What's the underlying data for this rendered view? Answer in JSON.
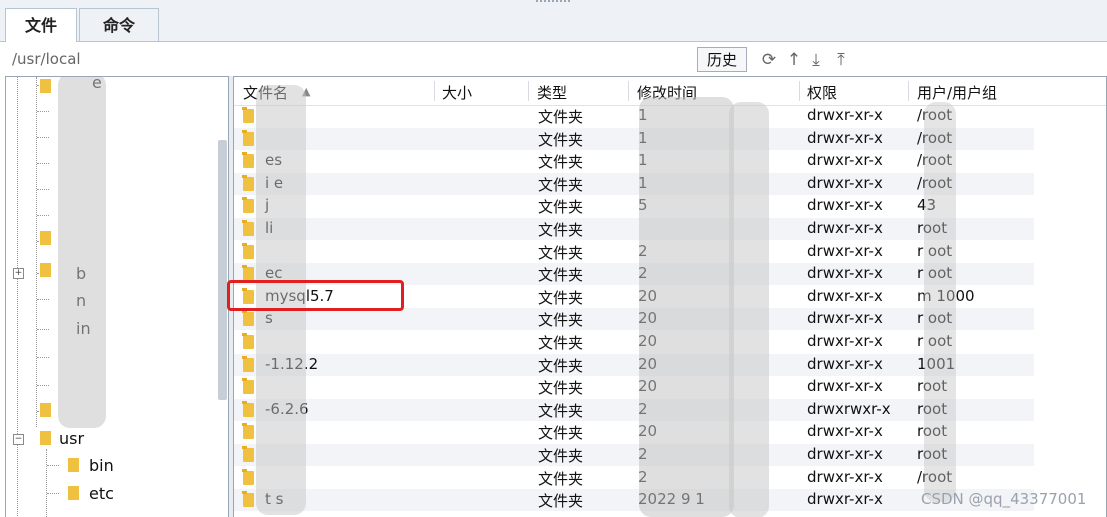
{
  "tabs": [
    {
      "label": "文件",
      "active": true
    },
    {
      "label": "命令",
      "active": false
    }
  ],
  "path": "/usr/local",
  "toolbar": {
    "history_label": "历史",
    "icons": [
      "refresh-icon",
      "up-arrow-icon",
      "download-icon",
      "upload-icon"
    ]
  },
  "tree": {
    "items": [
      {
        "label": "e"
      },
      {
        "label": "b"
      },
      {
        "label": "n"
      },
      {
        "label": "in"
      },
      {
        "label": "usr"
      },
      {
        "label": "bin"
      },
      {
        "label": "etc"
      }
    ]
  },
  "table": {
    "headers": {
      "name": "文件名",
      "size": "大小",
      "type": "类型",
      "mtime": "修改时间",
      "perm": "权限",
      "owner": "用户/用户组"
    },
    "rows": [
      {
        "name": "",
        "type": "文件夹",
        "mtime": "1",
        "perm": "drwxr-xr-x",
        "owner": "/root"
      },
      {
        "name": "",
        "type": "文件夹",
        "mtime": "1",
        "perm": "drwxr-xr-x",
        "owner": "/root"
      },
      {
        "name": "es",
        "type": "文件夹",
        "mtime": "1",
        "perm": "drwxr-xr-x",
        "owner": "/root"
      },
      {
        "name": "i    e",
        "type": "文件夹",
        "mtime": "1",
        "perm": "drwxr-xr-x",
        "owner": "/root"
      },
      {
        "name": "j",
        "type": "文件夹",
        "mtime": "5",
        "perm": "drwxr-xr-x",
        "owner": "43"
      },
      {
        "name": "li",
        "type": "文件夹",
        "mtime": "",
        "perm": "drwxr-xr-x",
        "owner": "root"
      },
      {
        "name": "",
        "type": "文件夹",
        "mtime": "2",
        "perm": "drwxr-xr-x",
        "owner": "r   oot"
      },
      {
        "name": "ec",
        "type": "文件夹",
        "mtime": "2",
        "perm": "drwxr-xr-x",
        "owner": "r   oot"
      },
      {
        "name": "mysql5.7",
        "type": "文件夹",
        "mtime": "20",
        "perm": "drwxr-xr-x",
        "owner": "m    1000"
      },
      {
        "name": "s",
        "type": "文件夹",
        "mtime": "20",
        "perm": "drwxr-xr-x",
        "owner": "r   oot"
      },
      {
        "name": "",
        "type": "文件夹",
        "mtime": "20",
        "perm": "drwxr-xr-x",
        "owner": "r   oot"
      },
      {
        "name": "-1.12.2",
        "type": "文件夹",
        "mtime": "20",
        "perm": "drwxr-xr-x",
        "owner": "1001"
      },
      {
        "name": "",
        "type": "文件夹",
        "mtime": "20",
        "perm": "drwxr-xr-x",
        "owner": "root"
      },
      {
        "name": "-6.2.6",
        "type": "文件夹",
        "mtime": "2",
        "perm": "drwxrwxr-x",
        "owner": "root"
      },
      {
        "name": "",
        "type": "文件夹",
        "mtime": "20",
        "perm": "drwxr-xr-x",
        "owner": "root"
      },
      {
        "name": "",
        "type": "文件夹",
        "mtime": "2",
        "perm": "drwxr-xr-x",
        "owner": "root"
      },
      {
        "name": "",
        "type": "文件夹",
        "mtime": "2",
        "perm": "drwxr-xr-x",
        "owner": "/root"
      },
      {
        "name": "t    s",
        "type": "文件夹",
        "mtime": "2022    9 1",
        "perm": "drwxr-xr-x",
        "owner": ""
      }
    ]
  },
  "watermark": "CSDN @qq_43377001",
  "colors": {
    "highlight_box": "#e02020",
    "folder": "#f0c141"
  }
}
